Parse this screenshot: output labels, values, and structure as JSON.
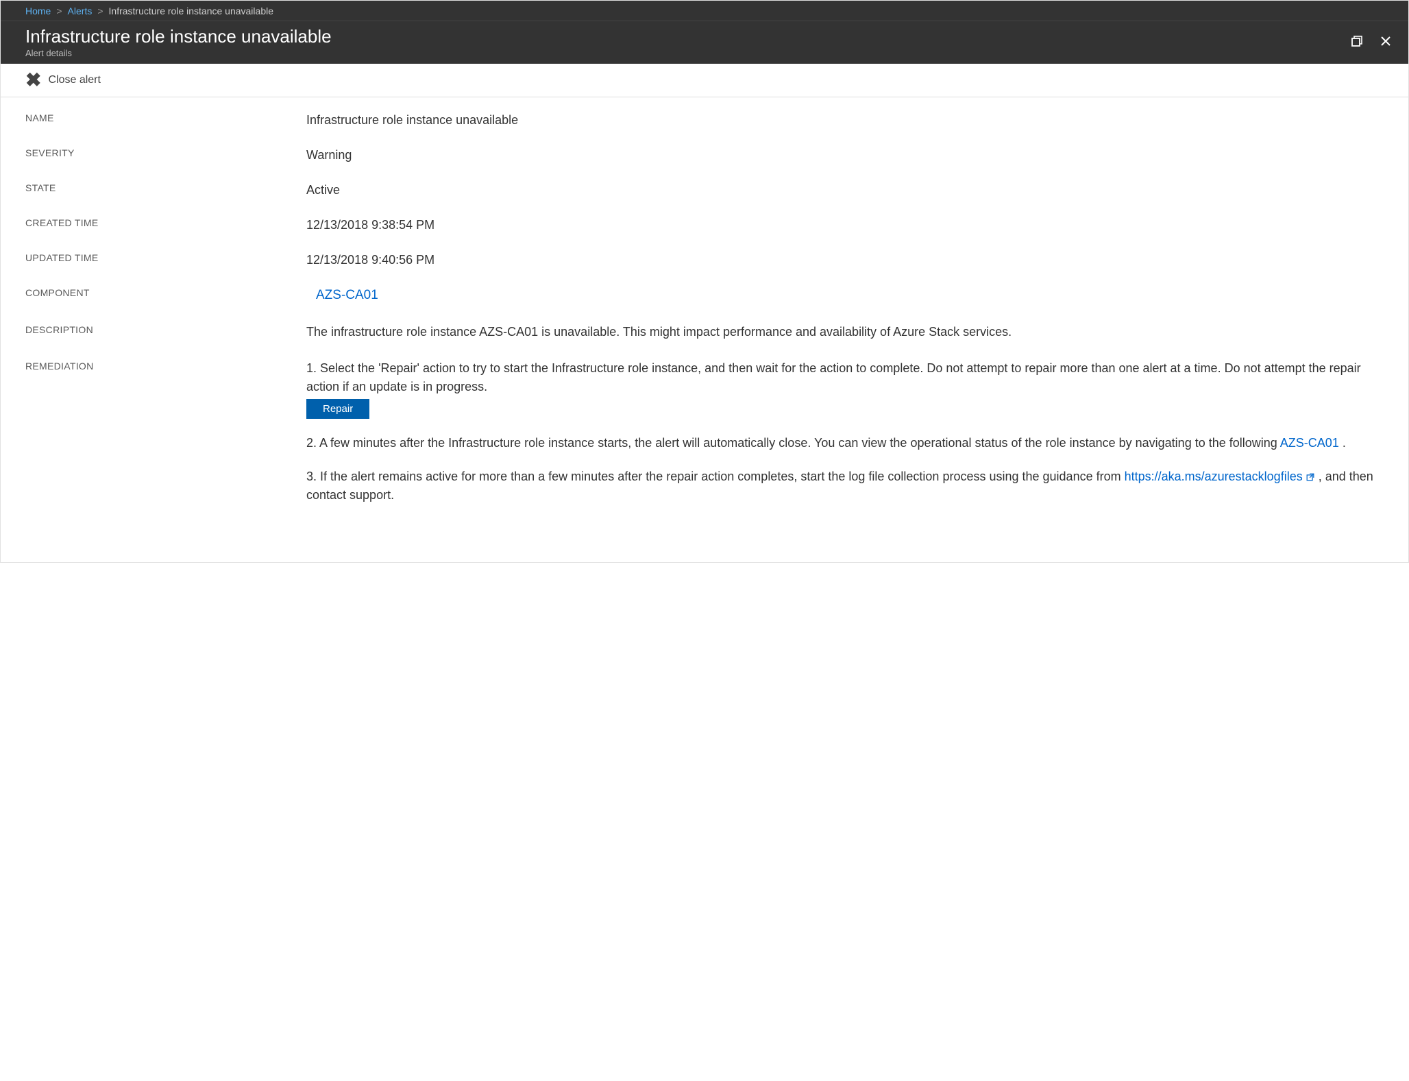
{
  "breadcrumb": {
    "home": "Home",
    "alerts": "Alerts",
    "current": "Infrastructure role instance unavailable",
    "sep": ">"
  },
  "header": {
    "title": "Infrastructure role instance unavailable",
    "subtitle": "Alert details"
  },
  "toolbar": {
    "close_label": "Close alert"
  },
  "fields": {
    "name_label": "NAME",
    "name_value": "Infrastructure role instance unavailable",
    "severity_label": "SEVERITY",
    "severity_value": "Warning",
    "state_label": "STATE",
    "state_value": "Active",
    "created_label": "CREATED TIME",
    "created_value": "12/13/2018 9:38:54 PM",
    "updated_label": "UPDATED TIME",
    "updated_value": "12/13/2018 9:40:56 PM",
    "component_label": "COMPONENT",
    "component_value": "AZS-CA01",
    "description_label": "DESCRIPTION",
    "description_value": "The infrastructure role instance AZS-CA01 is unavailable. This might impact performance and availability of Azure Stack services.",
    "remediation_label": "REMEDIATION"
  },
  "remediation": {
    "step1": "1. Select the 'Repair' action to try to start the Infrastructure role instance, and then wait for the action to complete. Do not attempt to repair more than one alert at a time. Do not attempt the repair action if an update is in progress.",
    "repair_button": "Repair",
    "step2_a": "2. A few minutes after the Infrastructure role instance starts, the alert will automatically close. You can view the operational status of the role instance by navigating to the following ",
    "step2_link": "AZS-CA01",
    "step2_b": " .",
    "step3_a": "3. If the alert remains active for more than a few minutes after the repair action completes, start the log file collection process using the guidance from ",
    "step3_link": "https://aka.ms/azurestacklogfiles",
    "step3_b": " , and then contact support."
  }
}
